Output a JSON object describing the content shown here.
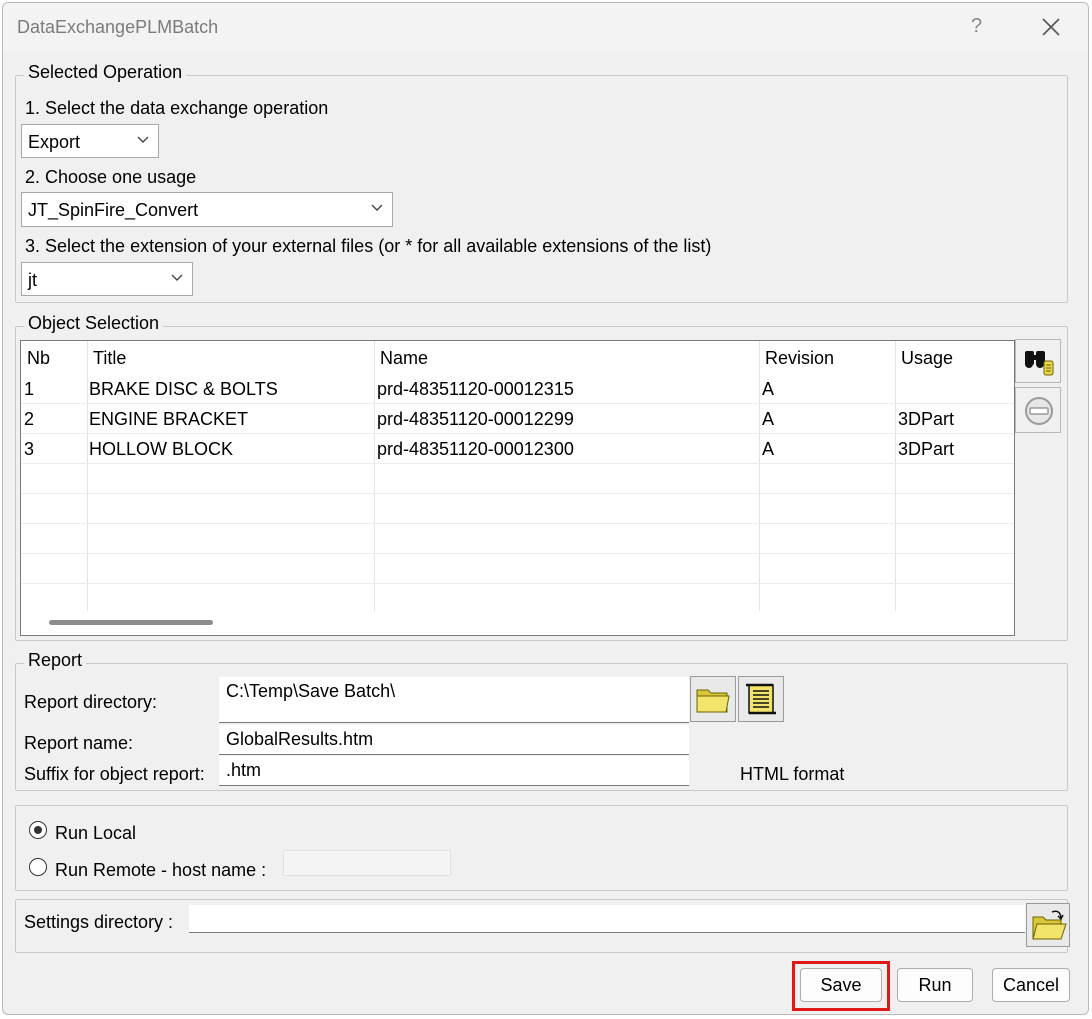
{
  "window": {
    "title": "DataExchangePLMBatch",
    "help": "?"
  },
  "selected_operation": {
    "legend": "Selected Operation",
    "step1_label": "1. Select the data exchange operation",
    "operation_value": "Export",
    "step2_label": "2. Choose one usage",
    "usage_value": "JT_SpinFire_Convert",
    "step3_label": "3. Select the extension of your external files (or * for all available extensions of the list)",
    "extension_value": "jt"
  },
  "object_selection": {
    "legend": "Object Selection",
    "columns": [
      "Nb",
      "Title",
      "Name",
      "Revision",
      "Usage"
    ],
    "rows": [
      [
        "1",
        "BRAKE DISC & BOLTS",
        "prd-48351120-00012315",
        "A",
        ""
      ],
      [
        "2",
        "ENGINE BRACKET",
        "prd-48351120-00012299",
        "A",
        "3DPart"
      ],
      [
        "3",
        "HOLLOW BLOCK",
        "prd-48351120-00012300",
        "A",
        "3DPart"
      ]
    ]
  },
  "report": {
    "legend": "Report",
    "directory_label": "Report directory:",
    "directory_value": "C:\\Temp\\Save Batch\\",
    "name_label": "Report name:",
    "name_value": "GlobalResults.htm",
    "suffix_label": "Suffix for object report:",
    "suffix_value": ".htm",
    "format_label": "HTML format"
  },
  "run_mode": {
    "local_label": "Run Local",
    "remote_label": "Run Remote - host name :",
    "selected": "local"
  },
  "settings": {
    "label": "Settings directory :",
    "value": ""
  },
  "buttons": {
    "save": "Save",
    "run": "Run",
    "cancel": "Cancel"
  },
  "colors": {
    "highlight": "#e01818",
    "folder": "#e8d84a"
  }
}
